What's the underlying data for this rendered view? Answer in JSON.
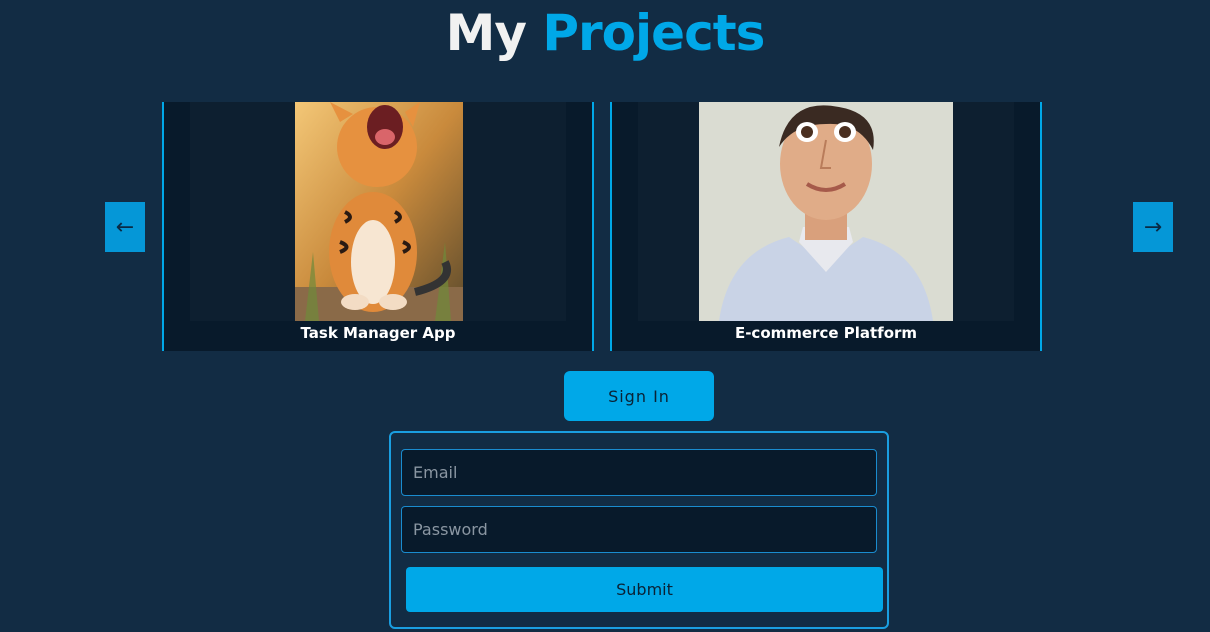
{
  "header": {
    "title_word1": "My",
    "title_word2": "Projects"
  },
  "carousel": {
    "prev_arrow": "←",
    "next_arrow": "→",
    "cards": [
      {
        "title": "Task Manager App",
        "image": "tiger-cub-yawning"
      },
      {
        "title": "E-commerce Platform",
        "image": "cartoon-man-portrait"
      }
    ]
  },
  "auth": {
    "signin_label": "Sign In",
    "email_placeholder": "Email",
    "password_placeholder": "Password",
    "submit_label": "Submit"
  },
  "colors": {
    "background": "#122c44",
    "accent": "#00a8e8",
    "card": "#081a2b"
  }
}
